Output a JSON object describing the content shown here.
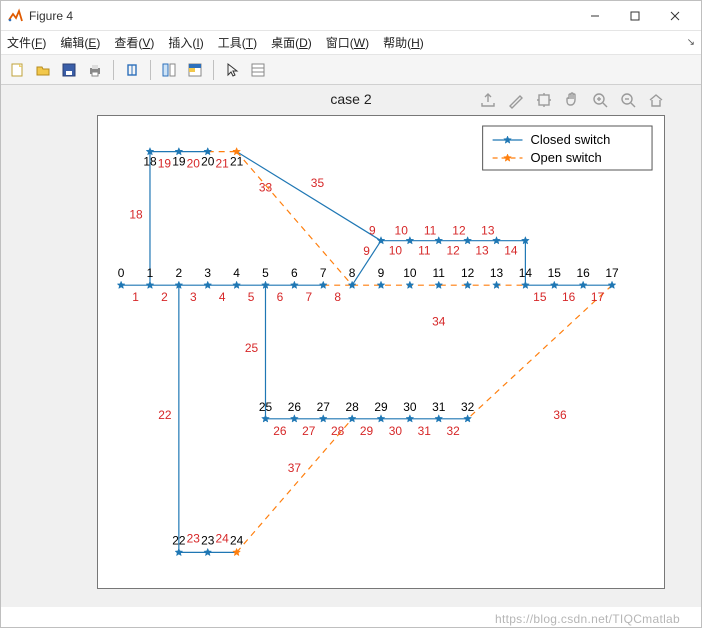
{
  "window": {
    "title": "Figure 4",
    "min_tip": "Minimize",
    "max_tip": "Maximize",
    "close_tip": "Close"
  },
  "menu": {
    "items": [
      {
        "label": "文件",
        "hotkey": "F"
      },
      {
        "label": "编辑",
        "hotkey": "E"
      },
      {
        "label": "查看",
        "hotkey": "V"
      },
      {
        "label": "插入",
        "hotkey": "I"
      },
      {
        "label": "工具",
        "hotkey": "T"
      },
      {
        "label": "桌面",
        "hotkey": "D"
      },
      {
        "label": "窗口",
        "hotkey": "W"
      },
      {
        "label": "帮助",
        "hotkey": "H"
      }
    ]
  },
  "toolbar": {
    "icons": [
      "new",
      "open",
      "save",
      "print",
      "|",
      "link",
      "|",
      "datacursor",
      "colorbar",
      "|",
      "pointer",
      "inspect"
    ]
  },
  "axes_toolbar": {
    "icons": [
      "export",
      "brush",
      "rotate3d",
      "pan",
      "zoom-in",
      "zoom-out",
      "home"
    ]
  },
  "chart_data": {
    "type": "network-graph",
    "title": "case 2",
    "legend": {
      "entries": [
        {
          "name": "Closed switch",
          "style": "closed",
          "color": "#1f77b4",
          "marker": "*"
        },
        {
          "name": "Open switch",
          "style": "open",
          "color": "#ff7f0e",
          "marker": "*",
          "dash": "4 3"
        }
      ],
      "position": "northeast"
    },
    "axes": {
      "xrange": [
        -0.8,
        18.8
      ],
      "yrange": [
        -6.8,
        3.8
      ],
      "box": true,
      "ticks": false
    },
    "nodes": [
      {
        "id": 0,
        "x": 0,
        "y": 0
      },
      {
        "id": 1,
        "x": 1,
        "y": 0
      },
      {
        "id": 2,
        "x": 2,
        "y": 0
      },
      {
        "id": 3,
        "x": 3,
        "y": 0
      },
      {
        "id": 4,
        "x": 4,
        "y": 0
      },
      {
        "id": 5,
        "x": 5,
        "y": 0
      },
      {
        "id": 6,
        "x": 6,
        "y": 0
      },
      {
        "id": 7,
        "x": 7,
        "y": 0
      },
      {
        "id": 8,
        "x": 8,
        "y": 0
      },
      {
        "id": 9,
        "x": 9,
        "y": 0
      },
      {
        "id": 10,
        "x": 10,
        "y": 0
      },
      {
        "id": 11,
        "x": 11,
        "y": 0
      },
      {
        "id": 12,
        "x": 12,
        "y": 0
      },
      {
        "id": 13,
        "x": 13,
        "y": 0
      },
      {
        "id": 14,
        "x": 14,
        "y": 0
      },
      {
        "id": 15,
        "x": 15,
        "y": 0
      },
      {
        "id": 16,
        "x": 16,
        "y": 0
      },
      {
        "id": 17,
        "x": 17,
        "y": 0
      },
      {
        "id": 18,
        "x": 1,
        "y": 3
      },
      {
        "id": 19,
        "x": 2,
        "y": 3
      },
      {
        "id": 20,
        "x": 3,
        "y": 3
      },
      {
        "id": 21,
        "x": 4,
        "y": 3
      },
      {
        "id": 22,
        "x": 2,
        "y": -6
      },
      {
        "id": 23,
        "x": 3,
        "y": -6
      },
      {
        "id": 24,
        "x": 4,
        "y": -6
      },
      {
        "id": 25,
        "x": 5,
        "y": -3
      },
      {
        "id": 26,
        "x": 6,
        "y": -3
      },
      {
        "id": 27,
        "x": 7,
        "y": -3
      },
      {
        "id": 28,
        "x": 8,
        "y": -3
      },
      {
        "id": 29,
        "x": 9,
        "y": -3
      },
      {
        "id": 30,
        "x": 10,
        "y": -3
      },
      {
        "id": 31,
        "x": 11,
        "y": -3
      },
      {
        "id": 32,
        "x": 12,
        "y": -3
      },
      {
        "id": 33,
        "x": 9,
        "y": 1
      },
      {
        "id": 34,
        "x": 10,
        "y": 1
      },
      {
        "id": 35,
        "x": 11,
        "y": 1
      },
      {
        "id": 36,
        "x": 12,
        "y": 1
      },
      {
        "id": 37,
        "x": 13,
        "y": 1
      },
      {
        "id": 38,
        "x": 14,
        "y": 1
      }
    ],
    "nodes_unlabeled": [
      33,
      34,
      35,
      36,
      37,
      38
    ],
    "edges_closed": [
      {
        "id": 1,
        "from": 0,
        "to": 1
      },
      {
        "id": 2,
        "from": 1,
        "to": 2
      },
      {
        "id": 3,
        "from": 2,
        "to": 3
      },
      {
        "id": 4,
        "from": 3,
        "to": 4
      },
      {
        "id": 5,
        "from": 4,
        "to": 5
      },
      {
        "id": 6,
        "from": 5,
        "to": 6
      },
      {
        "id": 7,
        "from": 6,
        "to": 7
      },
      {
        "id": 9,
        "from": 8,
        "to": 33
      },
      {
        "id": 10,
        "from": 33,
        "to": 34,
        "label_fix": "10"
      },
      {
        "id": 11,
        "from": 34,
        "to": 35,
        "label_fix": "11"
      },
      {
        "id": 12,
        "from": 35,
        "to": 36,
        "label_fix": "12"
      },
      {
        "id": 13,
        "from": 36,
        "to": 37,
        "label_fix": "13"
      },
      {
        "id": 14,
        "from": 37,
        "to": 38,
        "label_fix": "14",
        "extend_to": 14
      },
      {
        "id": 15,
        "from": 14,
        "to": 15
      },
      {
        "id": 16,
        "from": 15,
        "to": 16
      },
      {
        "id": 17,
        "from": 16,
        "to": 17
      },
      {
        "id": 18,
        "from": 1,
        "to": 18
      },
      {
        "id": 19,
        "from": 18,
        "to": 19
      },
      {
        "id": 20,
        "from": 19,
        "to": 20
      },
      {
        "id": 22,
        "from": 2,
        "to": 22
      },
      {
        "id": 23,
        "from": 22,
        "to": 23
      },
      {
        "id": 24,
        "from": 23,
        "to": 24
      },
      {
        "id": 25,
        "from": 5,
        "to": 25
      },
      {
        "id": 26,
        "from": 25,
        "to": 26
      },
      {
        "id": 27,
        "from": 26,
        "to": 27
      },
      {
        "id": 28,
        "from": 27,
        "to": 28
      },
      {
        "id": 29,
        "from": 28,
        "to": 29
      },
      {
        "id": 30,
        "from": 29,
        "to": 30
      },
      {
        "id": 31,
        "from": 30,
        "to": 31
      },
      {
        "id": 32,
        "from": 31,
        "to": 32
      },
      {
        "id": 35,
        "from": 21,
        "to": 33,
        "label_at": [
          6.8,
          2.2
        ]
      }
    ],
    "edges_open": [
      {
        "id": 8,
        "from": 7,
        "to": 8
      },
      {
        "id": 21,
        "from": 20,
        "to": 21
      },
      {
        "id": 33,
        "from": 21,
        "to": 8,
        "label_at": [
          5.0,
          2.1
        ]
      },
      {
        "id": 34,
        "from": 8,
        "to": 14,
        "label_at": [
          11.0,
          -0.9
        ]
      },
      {
        "id": 36,
        "from": 17,
        "to": 32,
        "label_at": [
          15.2,
          -3.0
        ]
      },
      {
        "id": 37,
        "from": 24,
        "to": 28,
        "label_at": [
          6.0,
          -4.2
        ]
      }
    ],
    "node_label_below": {
      "9": "9",
      "10": "10",
      "11": "11",
      "12": "12",
      "13": "13"
    }
  },
  "watermark": "https://blog.csdn.net/TIQCmatlab"
}
